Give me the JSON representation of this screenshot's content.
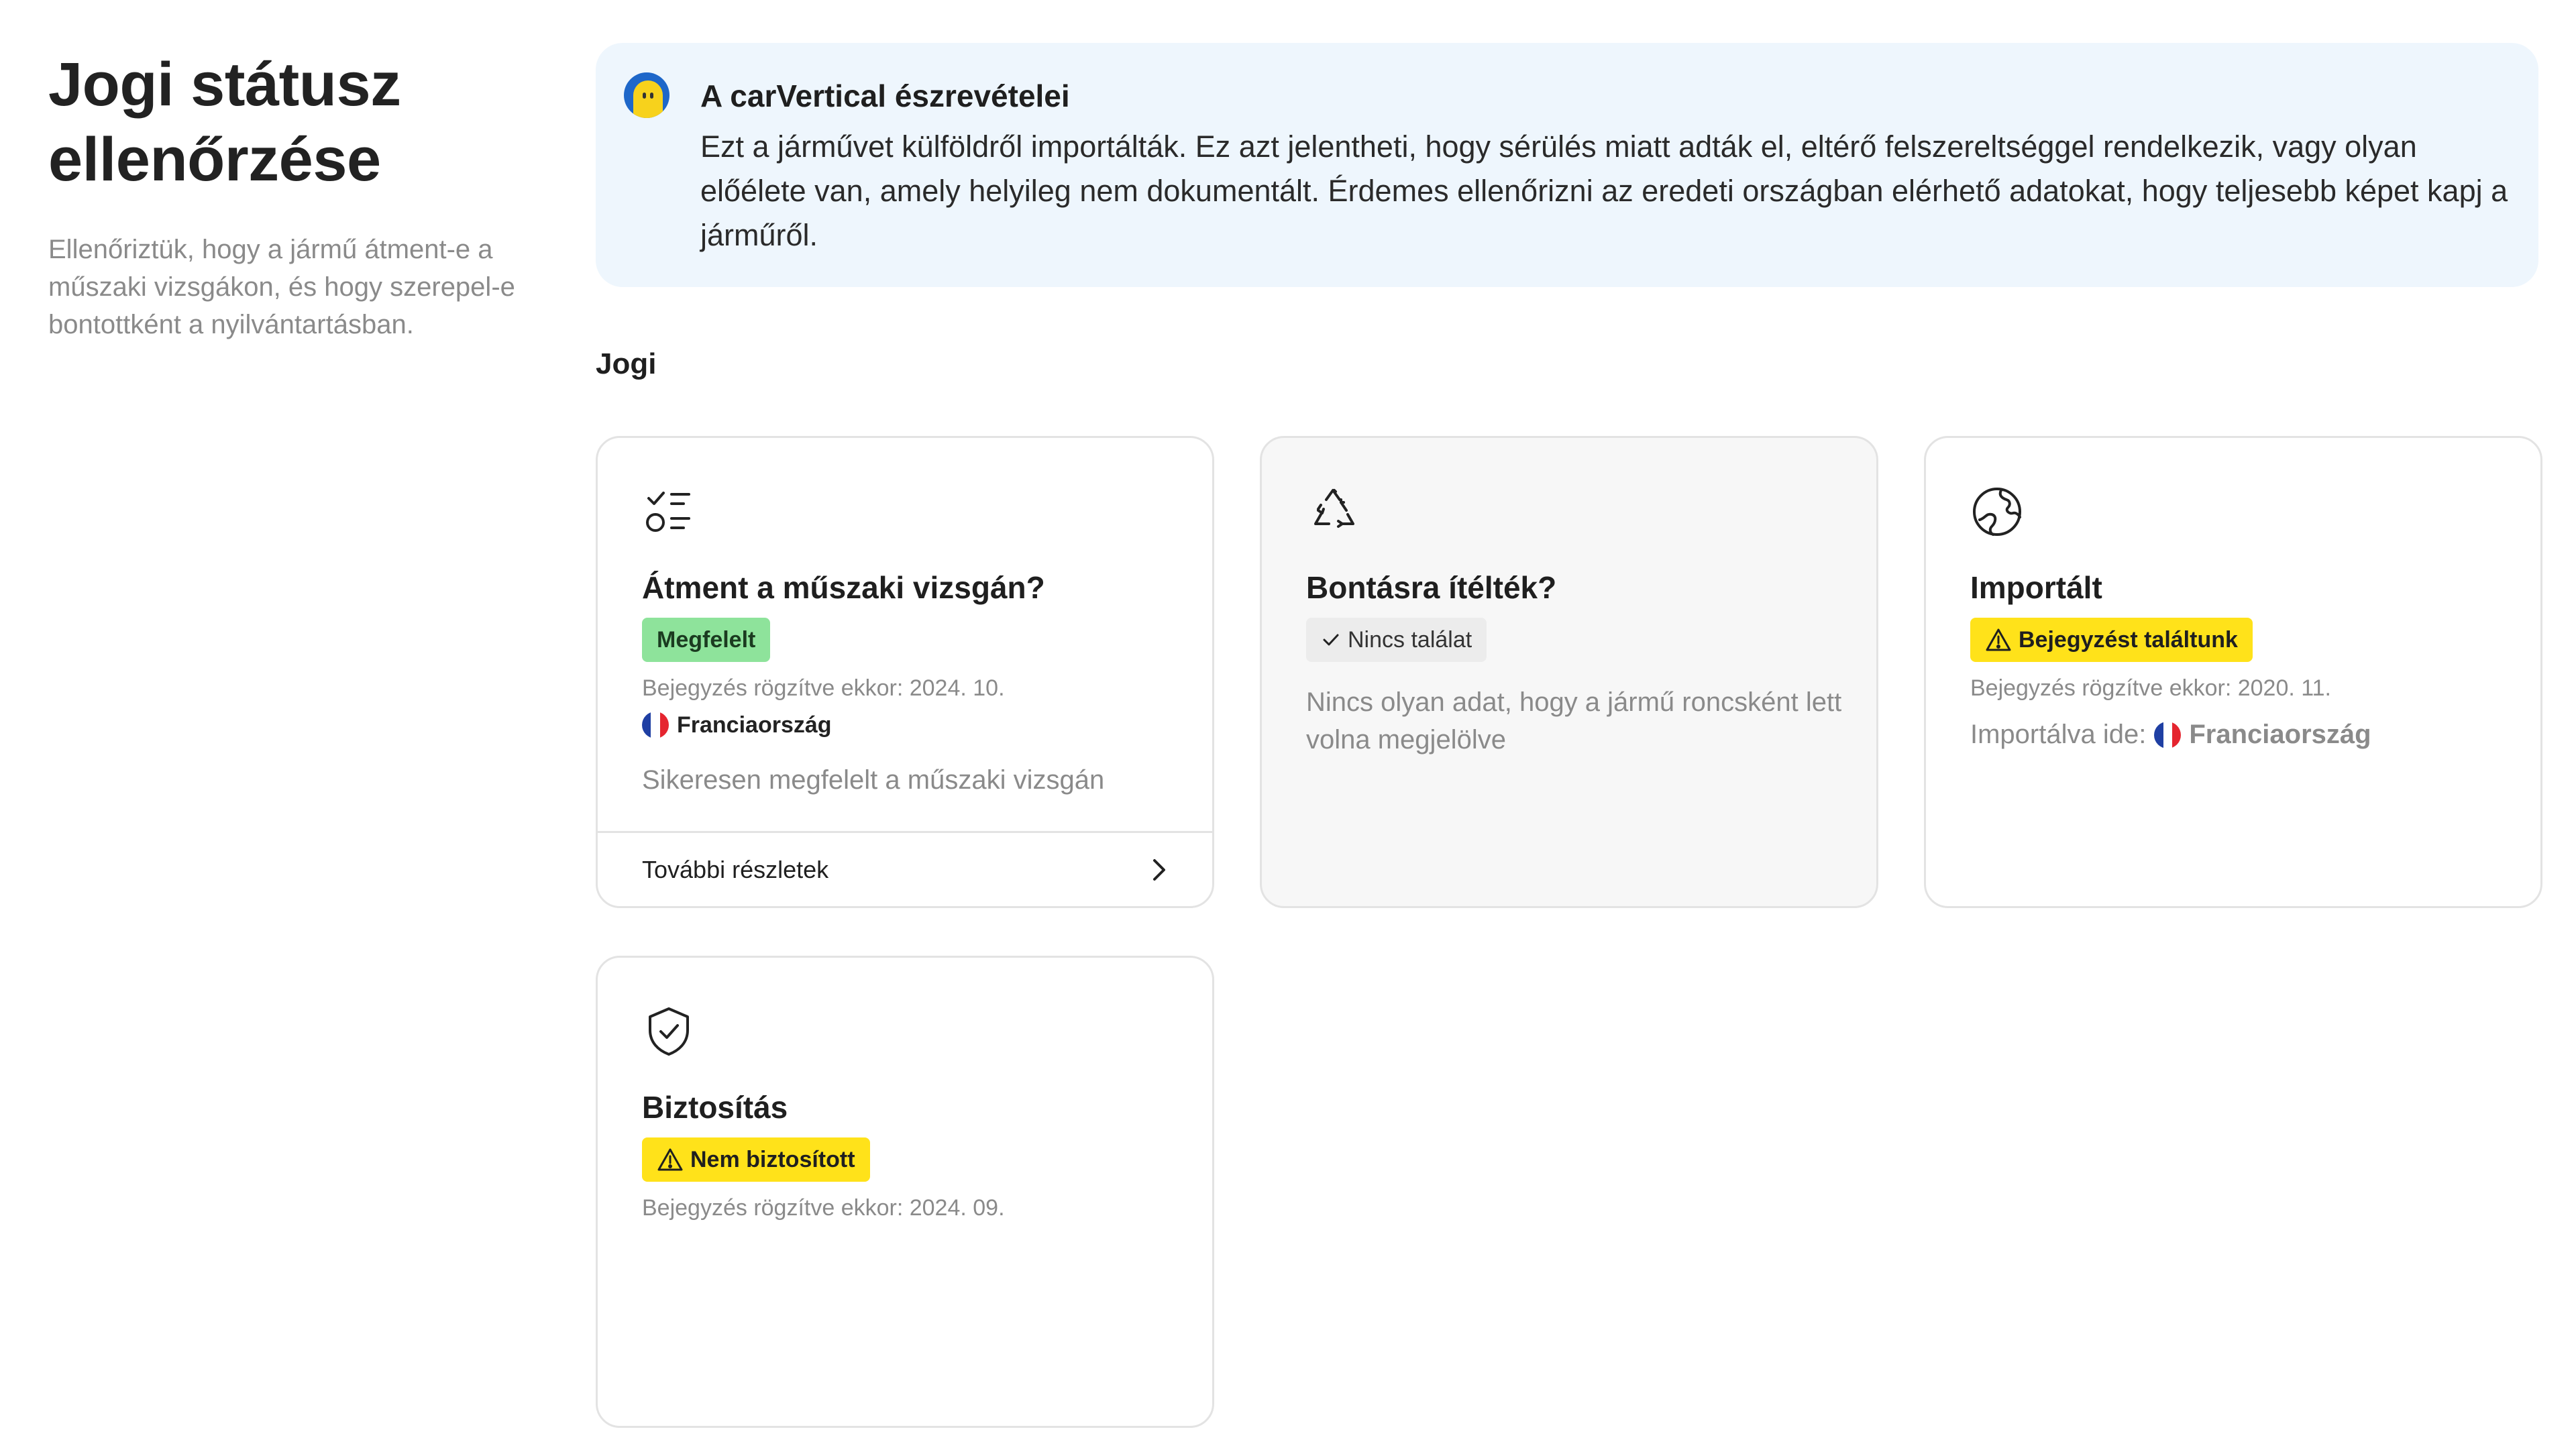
{
  "header": {
    "title": "Jogi státusz ellenőrzése",
    "description": "Ellenőriztük, hogy a jármű átment-e a műszaki vizsgákon, és hogy szerepel-e bontottként a nyilvántartásban."
  },
  "notice": {
    "title": "A carVertical észrevételei",
    "text": "Ezt a járművet külföldről importálták. Ez azt jelentheti, hogy sérülés miatt adták el, eltérő felszereltséggel rendelkezik, vagy olyan előélete van, amely helyileg nem dokumentált. Érdemes ellenőrizni az eredeti országban elérhető adatokat, hogy teljesebb képet kapj a járműről."
  },
  "section": {
    "title": "Jogi"
  },
  "cards": {
    "inspection": {
      "icon": "checklist-icon",
      "title": "Átment a műszaki vizsgán?",
      "badge": "Megfelelt",
      "recorded": "Bejegyzés rögzítve ekkor: 2024. 10.",
      "country": "Franciaország",
      "description": "Sikeresen megfelelt a műszaki vizsgán",
      "more_label": "További részletek"
    },
    "scrapped": {
      "icon": "recycle-icon",
      "title": "Bontásra ítélték?",
      "badge": "Nincs találat",
      "description": "Nincs olyan adat, hogy a jármű roncsként lett volna megjelölve"
    },
    "imported": {
      "icon": "globe-icon",
      "title": "Importált",
      "badge": "Bejegyzést találtunk",
      "recorded": "Bejegyzés rögzítve ekkor: 2020. 11.",
      "imported_to_label": "Importálva ide:",
      "country": "Franciaország"
    },
    "insurance": {
      "icon": "shield-check-icon",
      "title": "Biztosítás",
      "badge": "Nem biztosított",
      "recorded": "Bejegyzés rögzítve ekkor: 2024. 09."
    }
  },
  "colors": {
    "notice_bg": "#eef6fd",
    "badge_green": "#8ee39b",
    "badge_yellow": "#ffe21a",
    "badge_grey": "#ececec",
    "flag_blue": "#1f3fa3",
    "flag_red": "#e5252f"
  }
}
